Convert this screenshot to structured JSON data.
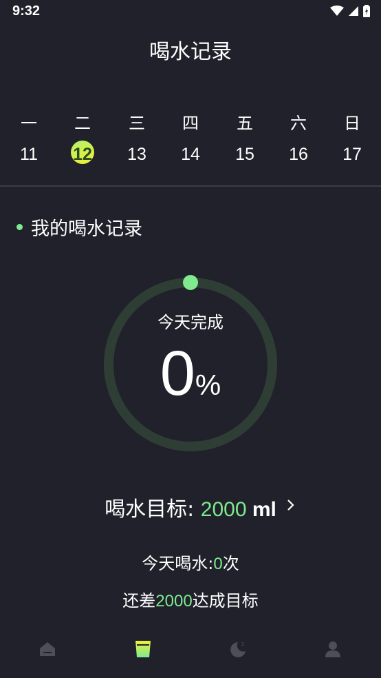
{
  "status": {
    "time": "9:32"
  },
  "header": {
    "title": "喝水记录"
  },
  "week": {
    "days": [
      {
        "weekday": "一",
        "date": "11",
        "selected": false
      },
      {
        "weekday": "二",
        "date": "12",
        "selected": true
      },
      {
        "weekday": "三",
        "date": "13",
        "selected": false
      },
      {
        "weekday": "四",
        "date": "14",
        "selected": false
      },
      {
        "weekday": "五",
        "date": "15",
        "selected": false
      },
      {
        "weekday": "六",
        "date": "16",
        "selected": false
      },
      {
        "weekday": "日",
        "date": "17",
        "selected": false
      }
    ]
  },
  "record": {
    "section_title": "我的喝水记录",
    "ring_label": "今天完成",
    "percent": "0",
    "percent_unit": "%",
    "progress_fraction": 0
  },
  "goal": {
    "label": "喝水目标: ",
    "value": "2000",
    "unit": " ml"
  },
  "today": {
    "prefix": "今天喝水:",
    "count": "0",
    "suffix": "次"
  },
  "remaining": {
    "prefix": "还差",
    "amount": "2000",
    "suffix": "达成目标"
  },
  "nav": {
    "items": [
      {
        "icon": "home-icon",
        "active": false
      },
      {
        "icon": "water-cup-icon",
        "active": true
      },
      {
        "icon": "moon-sleep-icon",
        "active": false
      },
      {
        "icon": "profile-icon",
        "active": false
      }
    ]
  },
  "colors": {
    "background": "#20212b",
    "accent": "#7fea8e",
    "ring_track": "#2f3e35",
    "nav_inactive": "#4c4e58"
  }
}
